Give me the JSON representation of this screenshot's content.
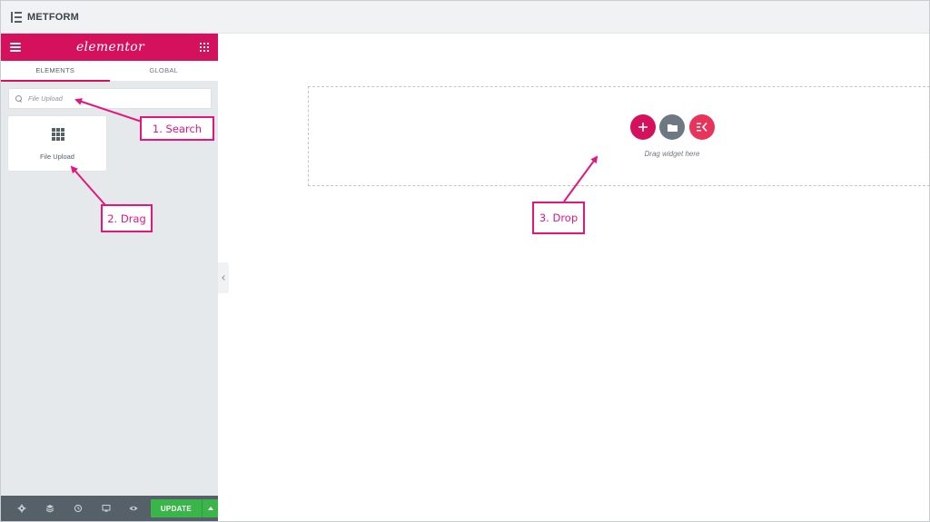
{
  "window": {
    "title": "METFORM"
  },
  "panel": {
    "brand": "elementor",
    "tabs": [
      {
        "label": "ELEMENTS",
        "active": true
      },
      {
        "label": "GLOBAL",
        "active": false
      }
    ],
    "search": {
      "value": "",
      "placeholder": "File Upload"
    },
    "widgets": [
      {
        "label": "File Upload",
        "icon": "grid-icon"
      }
    ],
    "footer": {
      "icons": [
        "gear-icon",
        "layers-icon",
        "history-icon",
        "desktop-icon",
        "eye-icon"
      ],
      "update_label": "UPDATE"
    }
  },
  "canvas": {
    "drop_text": "Drag widget here",
    "buttons": [
      "add-section-icon",
      "add-template-icon",
      "elementskit-icon"
    ]
  },
  "annotations": {
    "search": "1. Search",
    "drag": "2. Drag",
    "drop": "3. Drop"
  },
  "colors": {
    "brand": "#d5115e",
    "annotation": "#e6157e",
    "update": "#39b54a",
    "footer": "#556068"
  }
}
